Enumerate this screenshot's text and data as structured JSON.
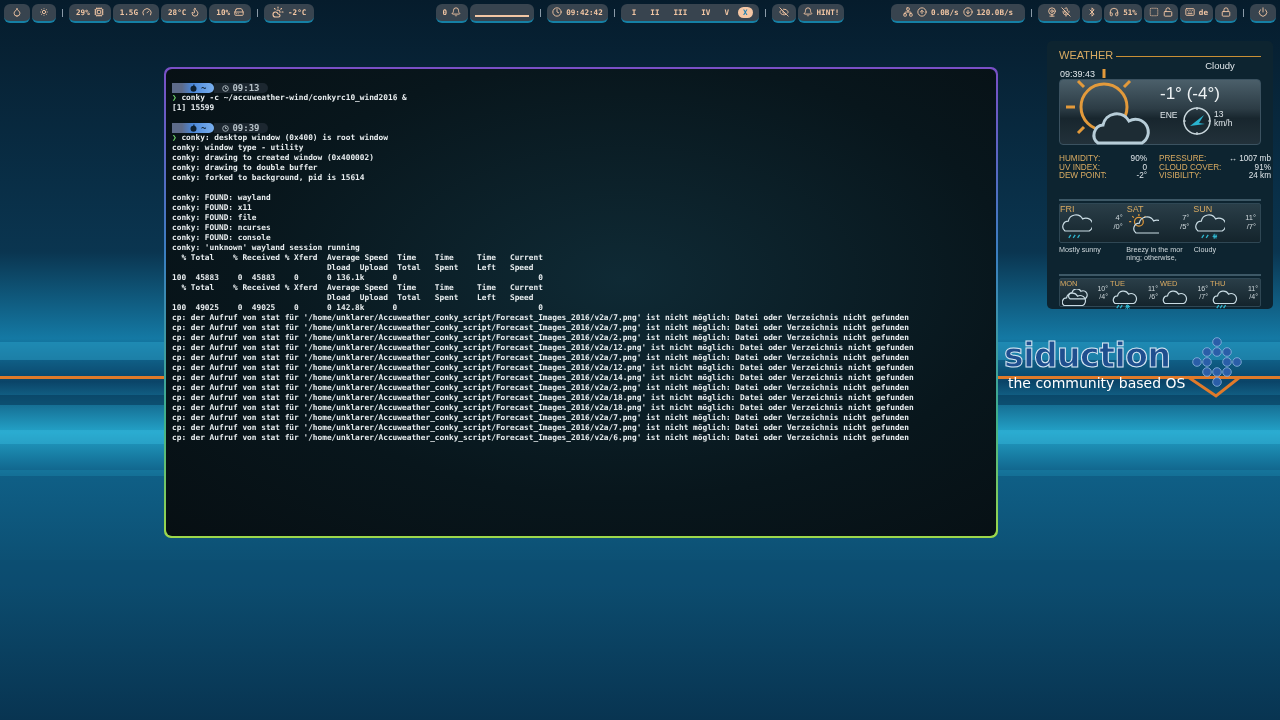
{
  "top_bar": {
    "cpu": "29%",
    "memory": "1.5G",
    "temperature": "28°C",
    "disk": "10%",
    "weather": "-2°C",
    "notifications": "0",
    "clock": "09:42:42",
    "workspaces": [
      {
        "label": "I",
        "selected": false
      },
      {
        "label": "II",
        "selected": false
      },
      {
        "label": "III",
        "selected": false
      },
      {
        "label": "IV",
        "selected": false
      },
      {
        "label": "V",
        "selected": false
      },
      {
        "label": "X",
        "selected": true
      }
    ],
    "hint": "HINT!",
    "network_down": "0.0B/s",
    "network_up": "120.0B/s",
    "headphones": "51%",
    "keyboard_layout": "de"
  },
  "terminal": {
    "blocks": [
      {
        "directory": "~",
        "time": "09:13",
        "prompt_symbol": "❯",
        "command": "conky -c ~/accuweather-wind/conkyrc10_wind2016 &",
        "paragraphs": [
          [
            "[1] 15599"
          ]
        ]
      },
      {
        "directory": "~",
        "time": "09:39",
        "prompt_symbol": "❯",
        "command": "conky: desktop window (0x400) is root window",
        "paragraphs": [
          [
            "conky: window type - utility",
            "conky: drawing to created window (0x400002)",
            "conky: drawing to double buffer",
            "conky: forked to background, pid is 15614"
          ],
          [
            "conky: FOUND: wayland",
            "conky: FOUND: x11",
            "conky: FOUND: file",
            "conky: FOUND: ncurses",
            "conky: FOUND: console",
            "conky: 'unknown' wayland session running",
            "  % Total    % Received % Xferd  Average Speed  Time    Time     Time   Current",
            "                                 Dload  Upload  Total   Spent    Left   Speed",
            "100  45883    0  45883    0      0 136.1k      0                              0",
            "  % Total    % Received % Xferd  Average Speed  Time    Time     Time   Current",
            "                                 Dload  Upload  Total   Spent    Left   Speed",
            "100  49025    0  49025    0      0 142.8k      0                              0",
            "cp: der Aufruf von stat für '/home/unklarer/Accuweather_conky_script/Forecast_Images_2016/v2a/7.png' ist nicht möglich: Datei oder Verzeichnis nicht gefunden",
            "cp: der Aufruf von stat für '/home/unklarer/Accuweather_conky_script/Forecast_Images_2016/v2a/7.png' ist nicht möglich: Datei oder Verzeichnis nicht gefunden",
            "cp: der Aufruf von stat für '/home/unklarer/Accuweather_conky_script/Forecast_Images_2016/v2a/2.png' ist nicht möglich: Datei oder Verzeichnis nicht gefunden",
            "cp: der Aufruf von stat für '/home/unklarer/Accuweather_conky_script/Forecast_Images_2016/v2a/12.png' ist nicht möglich: Datei oder Verzeichnis nicht gefunden",
            "cp: der Aufruf von stat für '/home/unklarer/Accuweather_conky_script/Forecast_Images_2016/v2a/7.png' ist nicht möglich: Datei oder Verzeichnis nicht gefunden",
            "cp: der Aufruf von stat für '/home/unklarer/Accuweather_conky_script/Forecast_Images_2016/v2a/12.png' ist nicht möglich: Datei oder Verzeichnis nicht gefunden",
            "cp: der Aufruf von stat für '/home/unklarer/Accuweather_conky_script/Forecast_Images_2016/v2a/14.png' ist nicht möglich: Datei oder Verzeichnis nicht gefunden",
            "cp: der Aufruf von stat für '/home/unklarer/Accuweather_conky_script/Forecast_Images_2016/v2a/2.png' ist nicht möglich: Datei oder Verzeichnis nicht gefunden",
            "cp: der Aufruf von stat für '/home/unklarer/Accuweather_conky_script/Forecast_Images_2016/v2a/18.png' ist nicht möglich: Datei oder Verzeichnis nicht gefunden",
            "cp: der Aufruf von stat für '/home/unklarer/Accuweather_conky_script/Forecast_Images_2016/v2a/18.png' ist nicht möglich: Datei oder Verzeichnis nicht gefunden",
            "cp: der Aufruf von stat für '/home/unklarer/Accuweather_conky_script/Forecast_Images_2016/v2a/7.png' ist nicht möglich: Datei oder Verzeichnis nicht gefunden",
            "cp: der Aufruf von stat für '/home/unklarer/Accuweather_conky_script/Forecast_Images_2016/v2a/7.png' ist nicht möglich: Datei oder Verzeichnis nicht gefunden",
            "cp: der Aufruf von stat für '/home/unklarer/Accuweather_conky_script/Forecast_Images_2016/v2a/6.png' ist nicht möglich: Datei oder Verzeichnis nicht gefunden"
          ]
        ]
      }
    ]
  },
  "weather": {
    "title": "WEATHER",
    "condition": "Cloudy",
    "time": "09:39:43",
    "temperature": "-1° (-4°)",
    "wind_direction": "ENE",
    "wind_speed": "13",
    "wind_unit": "km/h",
    "details": [
      {
        "label": "HUMIDITY:",
        "value": "90%"
      },
      {
        "label": "PRESSURE:",
        "value": "↔ 1007 mb"
      },
      {
        "label": "UV INDEX:",
        "value": "0"
      },
      {
        "label": "CLOUD COVER:",
        "value": "91%"
      },
      {
        "label": "DEW POINT:",
        "value": "-2°"
      },
      {
        "label": "VISIBILITY:",
        "value": "24 km"
      }
    ],
    "forecast": [
      {
        "day": "FRI",
        "kind": "rain",
        "high": "4°",
        "low": "/0°",
        "summary": [
          "Mostly sunny"
        ]
      },
      {
        "day": "SAT",
        "kind": "partly-sunny",
        "high": "7°",
        "low": "/5°",
        "summary": [
          "Breezy in the mor",
          "ning; otherwise,"
        ]
      },
      {
        "day": "SUN",
        "kind": "sleet",
        "high": "11°",
        "low": "/7°",
        "summary": [
          "Cloudy"
        ]
      }
    ],
    "extended": [
      {
        "day": "MON",
        "kind": "cloudy",
        "high": "10°",
        "low": "/4°"
      },
      {
        "day": "TUE",
        "kind": "sleet",
        "high": "11°",
        "low": "/6°"
      },
      {
        "day": "WED",
        "kind": "cloud",
        "high": "16°",
        "low": "/7°"
      },
      {
        "day": "THU",
        "kind": "rain",
        "high": "11°",
        "low": "/4°"
      }
    ]
  },
  "logo": {
    "name": "siduction",
    "tagline": "the community based OS"
  }
}
